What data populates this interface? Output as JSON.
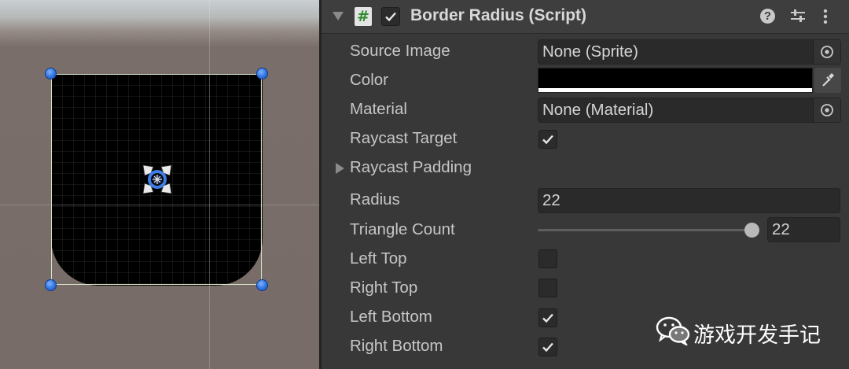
{
  "scene": {
    "handle_color": "#2f73e0",
    "shape_color": "#000000"
  },
  "inspector": {
    "component": {
      "title": "Border Radius (Script)",
      "enabled": true,
      "icons": [
        "help-icon",
        "presets-icon",
        "kebab-menu-icon"
      ]
    },
    "properties": {
      "source_image": {
        "label": "Source Image",
        "value": "None (Sprite)"
      },
      "color": {
        "label": "Color",
        "value_hex": "#000000"
      },
      "material": {
        "label": "Material",
        "value": "None (Material)"
      },
      "raycast_target": {
        "label": "Raycast Target",
        "checked": true
      },
      "raycast_padding": {
        "label": "Raycast Padding",
        "expanded": false
      },
      "radius": {
        "label": "Radius",
        "value": "22"
      },
      "triangle_count": {
        "label": "Triangle Count",
        "value": "22",
        "slider_fraction": 0.97
      },
      "left_top": {
        "label": "Left Top",
        "checked": false
      },
      "right_top": {
        "label": "Right Top",
        "checked": false
      },
      "left_bottom": {
        "label": "Left Bottom",
        "checked": true
      },
      "right_bottom": {
        "label": "Right Bottom",
        "checked": true
      }
    }
  },
  "watermark": {
    "text": "游戏开发手记",
    "icon": "wechat-logo"
  }
}
